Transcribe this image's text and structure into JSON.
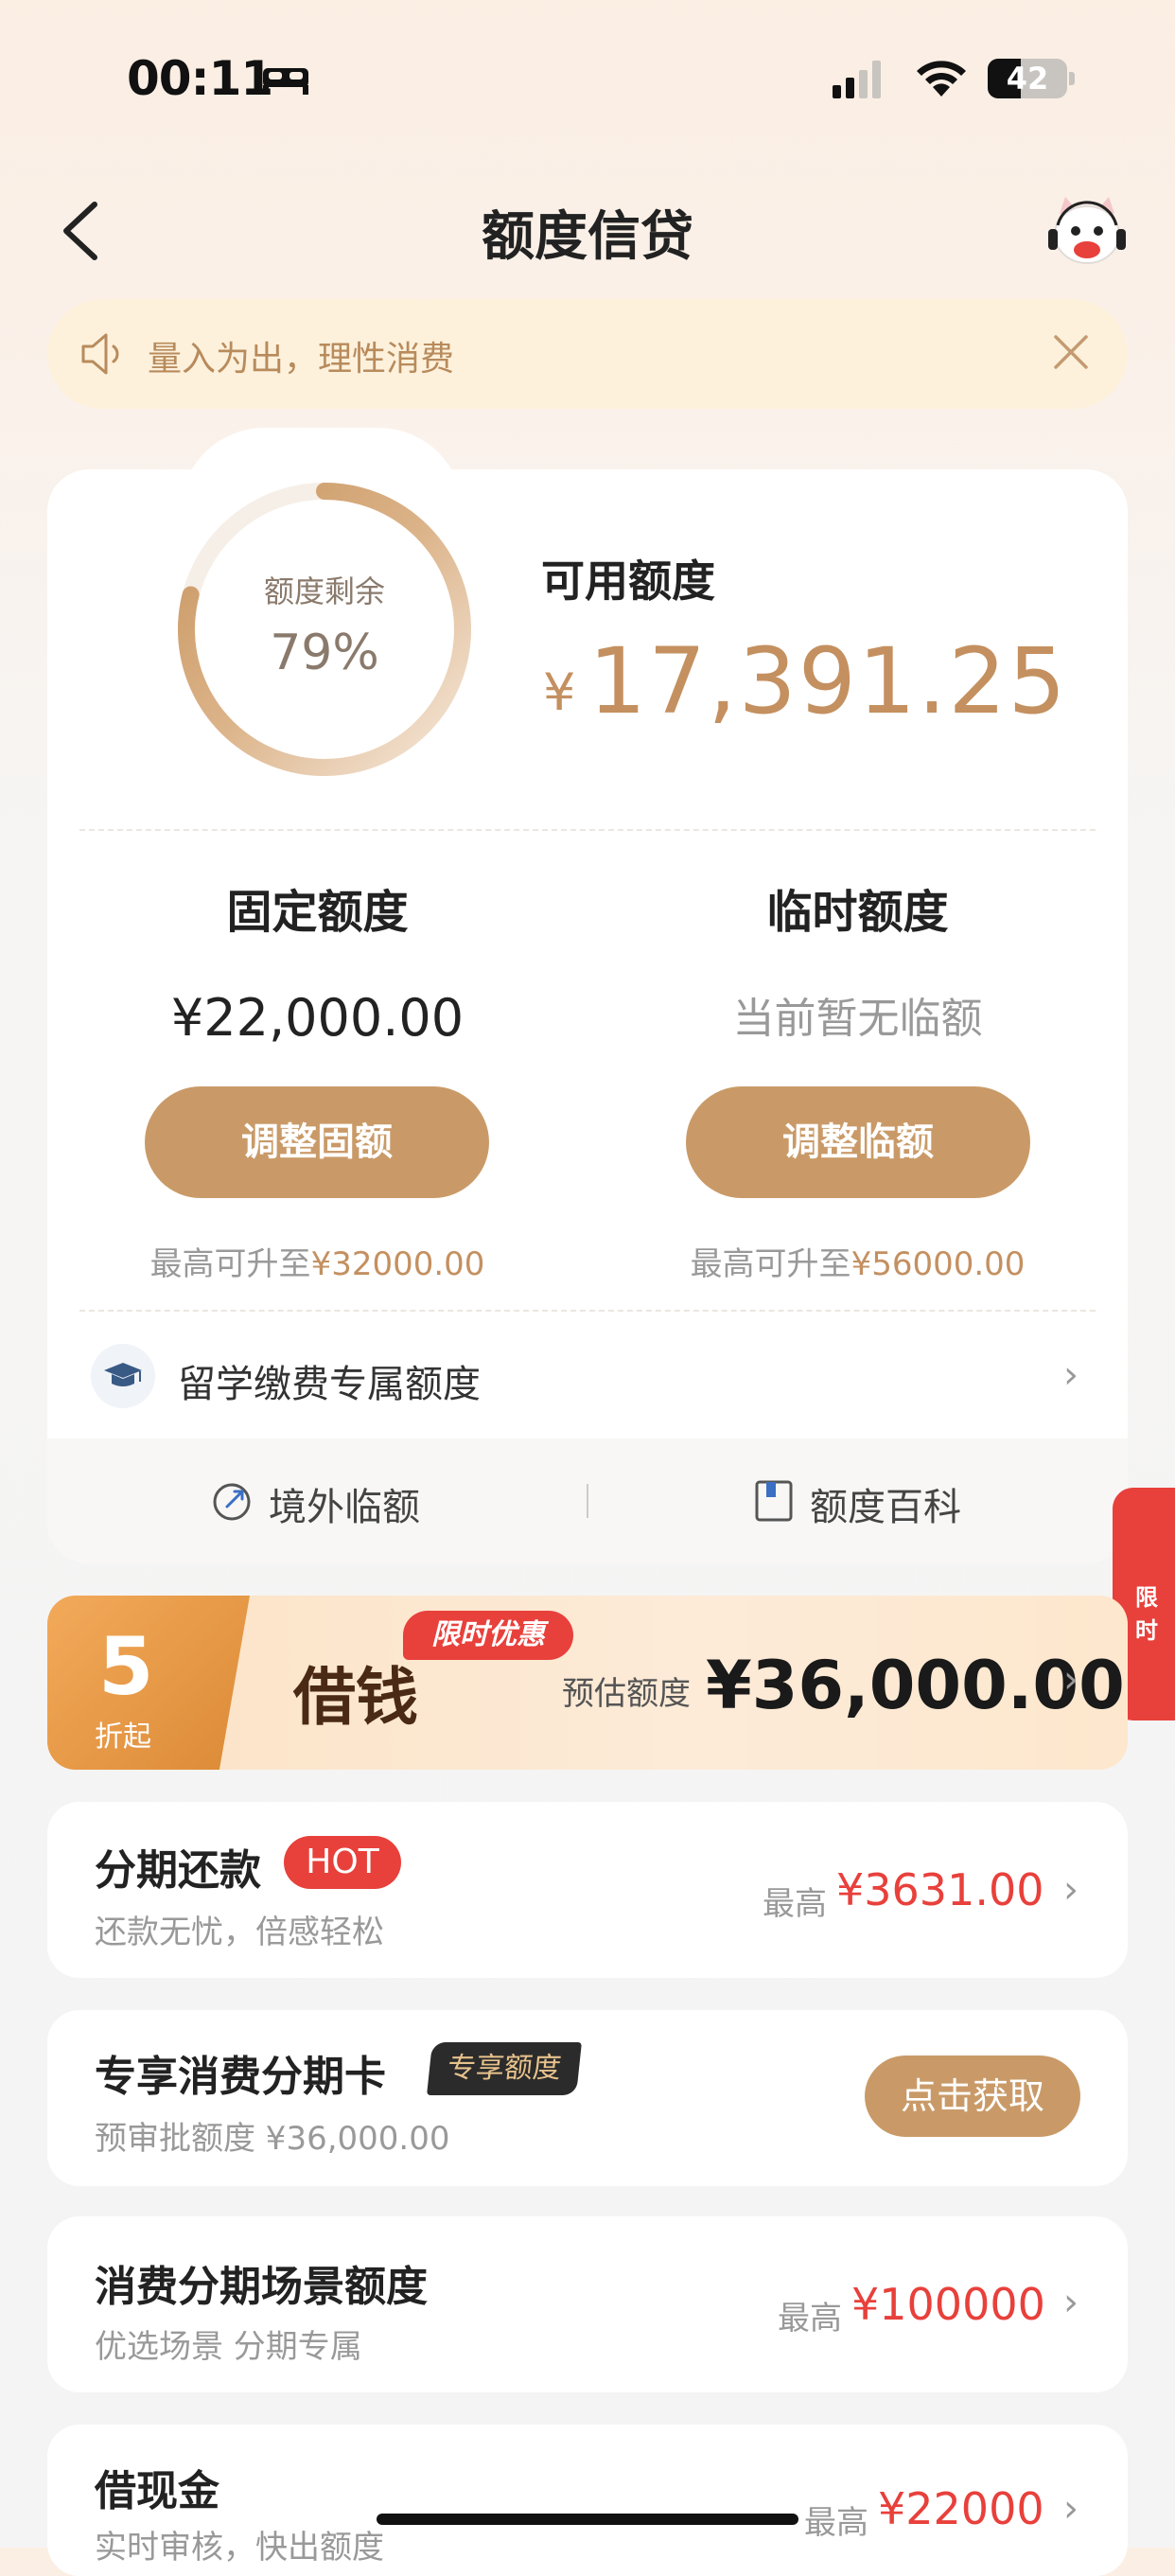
{
  "status_bar": {
    "time": "00:11",
    "battery": "42"
  },
  "nav": {
    "title": "额度信贷"
  },
  "notice": {
    "text": "量入为出，理性消费"
  },
  "credit": {
    "ring_label": "额度剩余",
    "ring_percent": "79%",
    "ring_fraction": 0.79,
    "available_label": "可用额度",
    "currency": "¥",
    "available_amount": "17,391.25",
    "fixed": {
      "title": "固定额度",
      "value": "¥22,000.00",
      "button": "调整固额",
      "max_prefix": "最高可升至",
      "max_value": "¥32000.00"
    },
    "temp": {
      "title": "临时额度",
      "value": "当前暂无临额",
      "button": "调整临额",
      "max_prefix": "最高可升至",
      "max_value": "¥56000.00"
    },
    "study_abroad": "留学缴费专属额度",
    "footer": {
      "overseas": "境外临额",
      "wiki": "额度百科"
    }
  },
  "side_tab": {
    "text": "限时"
  },
  "borrow": {
    "discount_number": "5",
    "discount_text": "折起",
    "limited_tag": "限时优惠",
    "title": "借钱",
    "estimate_label": "预估额度",
    "estimate_amount": "¥36,000.00"
  },
  "list": {
    "installment": {
      "title": "分期还款",
      "tag": "HOT",
      "sub": "还款无忧，倍感轻松",
      "max_label": "最高",
      "amount": "¥3631.00"
    },
    "card": {
      "title": "专享消费分期卡",
      "tag": "专享额度",
      "sub": "预审批额度 ¥36,000.00",
      "button": "点击获取"
    },
    "scene": {
      "title": "消费分期场景额度",
      "sub": "优选场景 分期专属",
      "max_label": "最高",
      "amount": "¥100000"
    },
    "cash": {
      "title": "借现金",
      "sub": "实时审核，快出额度",
      "max_label": "最高",
      "amount": "¥22000"
    }
  },
  "colors": {
    "accent": "#c99a68",
    "red": "#e8403b",
    "gold_text": "#c49060"
  }
}
